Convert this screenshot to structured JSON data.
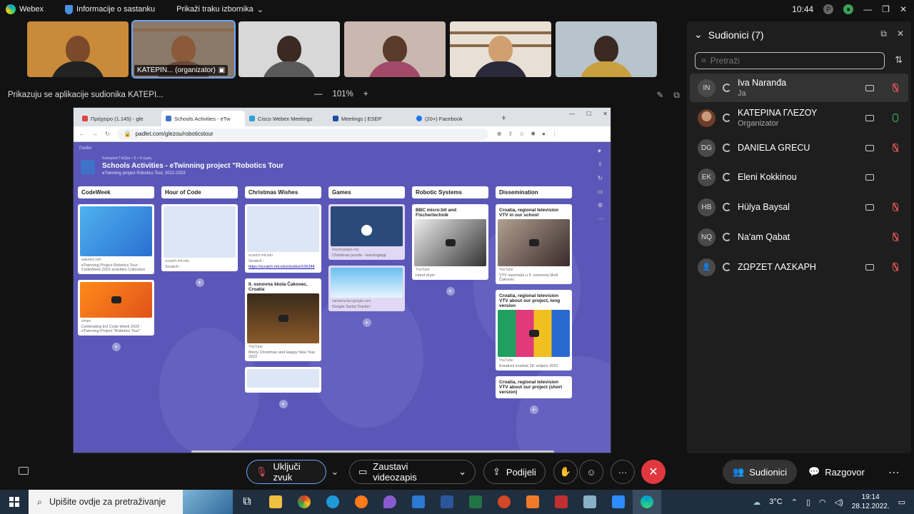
{
  "titlebar": {
    "app_name": "Webex",
    "meeting_info": "Informacije o sastanku",
    "show_menu": "Prikaži traku izbornika",
    "time": "10:44"
  },
  "video_strip": [
    {
      "label": ""
    },
    {
      "label": "ΚΑΤΕΡΙΝ... (organizator)"
    },
    {
      "label": ""
    },
    {
      "label": ""
    },
    {
      "label": ""
    },
    {
      "label": ""
    }
  ],
  "share_bar": {
    "text": "Prikazuju se aplikacije sudionika ΚΑΤΕΡΙ...",
    "zoom": "101%",
    "zoom_out": "—",
    "zoom_in": "+"
  },
  "browser": {
    "tabs": [
      "Πρόχειρο (1.145) - gle",
      "Schools Activities - eTw",
      "Cisco Webex Meetings",
      "Meetings | ESEP",
      "(20+) Facebook"
    ],
    "new_tab": "+",
    "url": "padlet.com/glezou/roboticstour"
  },
  "padlet": {
    "top": "Padlet",
    "byline": "Κατερίνα Γλέζου • 2 • 9 ώρες",
    "title": "Schools Activities - eTwinning project \"Robotics Tour",
    "subtitle": "eTwinning project Robotics Tour, 2022-2023",
    "columns": [
      {
        "name": "CodeWeek",
        "cards": [
          {
            "title": "",
            "meta": "wakelet.com",
            "text": "eTwinning Project Robotics Tour - CodeWeek 2022 activities Collection",
            "link": ""
          },
          {
            "title": "",
            "meta": "vimeo",
            "text": "Celebrating EU Code Week 2022 - eTwinning Project \"Robotics Tour\"",
            "link": ""
          }
        ]
      },
      {
        "name": "Hour of Code",
        "cards": [
          {
            "title": "",
            "meta": "scratch.mit.edu",
            "text": "Scratch -",
            "link": ""
          }
        ]
      },
      {
        "name": "Christmas Wishes",
        "cards": [
          {
            "title": "",
            "meta": "scratch.mit.edu",
            "text": "Scratch -",
            "link": "https://scratch.mit.edu/studios/106244"
          },
          {
            "title": "II. osnovna škola Čakovec, Croatia",
            "meta": "YouTube",
            "text": "Merry Christmas and Happy New Year 2022",
            "link": ""
          },
          {
            "title": "",
            "meta": "",
            "text": "",
            "link": ""
          }
        ]
      },
      {
        "name": "Games",
        "cards": [
          {
            "title": "",
            "meta": "learningapps.org",
            "text": "Christmas puzzle - learningapp",
            "link": ""
          },
          {
            "title": "",
            "meta": "santatracker.google.com",
            "text": "Google Santa Tracker",
            "link": ""
          }
        ]
      },
      {
        "name": "Robotic Systems",
        "cards": [
          {
            "title": "BBC micro:bit and Fischertechnik",
            "meta": "YouTube",
            "text": "Hand dryer",
            "link": ""
          }
        ]
      },
      {
        "name": "Dissemination",
        "cards": [
          {
            "title": "Croatia, regional television VTV in our school",
            "meta": "YouTube",
            "text": "VTV reportaža u II. osnovnoj školi Čakovec",
            "link": ""
          },
          {
            "title": "Croatia, regional television VTV about our project, long version",
            "meta": "YouTube",
            "text": "Kreativni kvadrat 18. veljače 2022",
            "link": ""
          },
          {
            "title": "Croatia, regional television VTV about our project (short version)",
            "meta": "",
            "text": "",
            "link": ""
          }
        ]
      }
    ]
  },
  "participants_panel": {
    "title": "Sudionici (7)",
    "search_placeholder": "Pretraži",
    "people": [
      {
        "initials": "IN",
        "name": "Iva Naranđa",
        "role": "Ja",
        "video": true,
        "mic": "muted"
      },
      {
        "initials": "",
        "name": "ΚΑΤΕΡΙΝΑ ΓΛΕΖΟΥ",
        "role": "Organizator",
        "video": true,
        "mic": "on"
      },
      {
        "initials": "DG",
        "name": "DANIELA GRECU",
        "role": "",
        "video": true,
        "mic": "muted"
      },
      {
        "initials": "EK",
        "name": "Eleni Kokkinou",
        "role": "",
        "video": true,
        "mic": "none"
      },
      {
        "initials": "HB",
        "name": "Hülya Baysal",
        "role": "",
        "video": true,
        "mic": "muted"
      },
      {
        "initials": "NQ",
        "name": "Na'am Qabat",
        "role": "",
        "video": false,
        "mic": "muted"
      },
      {
        "initials": "",
        "name": "ΖΩΡΖΕΤ ΛΑΣΚΑΡΗ",
        "role": "",
        "video": true,
        "mic": "muted"
      }
    ]
  },
  "controls": {
    "unmute": "Uključi zvuk",
    "stop_video": "Zaustavi videozapis",
    "share": "Podijeli",
    "more": "···",
    "participants": "Sudionici",
    "chat": "Razgovor"
  },
  "taskbar": {
    "search_placeholder": "Upišite ovdje za pretraživanje",
    "temperature": "3°C",
    "time": "19:14",
    "date": "28.12.2022."
  },
  "colors": {
    "accent": "#6aa6ff",
    "end_call": "#e0383e",
    "padlet_bg": "#5b57b8",
    "muted": "#e05555",
    "live_mic": "#3fbf5f"
  }
}
